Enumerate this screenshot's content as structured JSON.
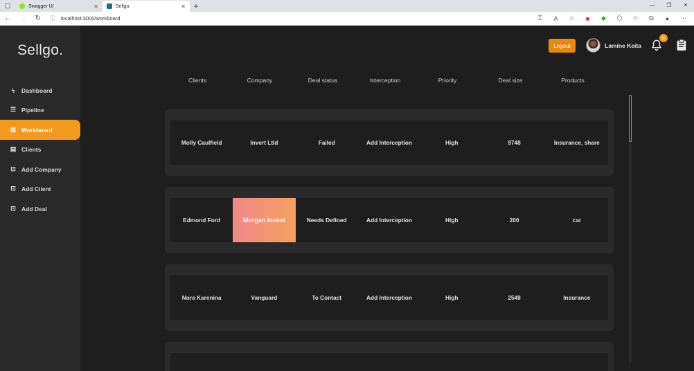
{
  "browser": {
    "tabs": [
      {
        "title": "Swagger UI",
        "fav_color": "#85ea2d"
      },
      {
        "title": "Sellgo.",
        "fav_color": "#1f6f7a"
      }
    ],
    "url": "localhost:3000/workboard"
  },
  "app": {
    "logo": "Sellgo.",
    "nav": [
      {
        "label": "Dashboard",
        "icon": "bolt-icon",
        "glyph": "ϟ"
      },
      {
        "label": "Pipeline",
        "icon": "list-icon",
        "glyph": "☰"
      },
      {
        "label": "Workboard",
        "icon": "grid-icon",
        "glyph": "▦"
      },
      {
        "label": "Clients",
        "icon": "clients-icon",
        "glyph": "▤"
      },
      {
        "label": "Add Company",
        "icon": "add-company-icon",
        "glyph": "⊡"
      },
      {
        "label": "Add Client",
        "icon": "add-client-icon",
        "glyph": "⊡"
      },
      {
        "label": "Add Deal",
        "icon": "add-deal-icon",
        "glyph": "⊡"
      }
    ],
    "active_nav": "Workboard",
    "accent": "#f39a1e"
  },
  "header": {
    "logout_label": "Logout",
    "user_name": "Lamine Keita",
    "notification_count": "0"
  },
  "table": {
    "columns": [
      "Clients",
      "Company",
      "Deal status",
      "Interception",
      "Priority",
      "Deal size",
      "Products"
    ],
    "rows": [
      [
        "Molly Caulfield",
        "Invert Ltld",
        "Failed",
        "Add Interception",
        "High",
        "9748",
        "Insurance, share"
      ],
      [
        "Edmond Ford",
        "Morgan Invest",
        "Needs Defined",
        "Add Interception",
        "High",
        "200",
        "car"
      ],
      [
        "Nora Karenina",
        "Vanguard",
        "To Contact",
        "Add Interception",
        "High",
        "2548",
        "Insurance"
      ]
    ]
  }
}
